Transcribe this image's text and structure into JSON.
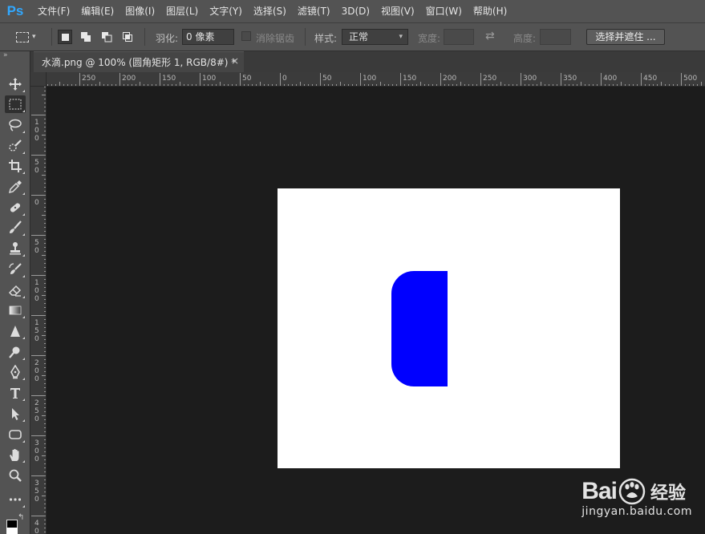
{
  "app": {
    "logo": "Ps"
  },
  "menu": [
    "文件(F)",
    "编辑(E)",
    "图像(I)",
    "图层(L)",
    "文字(Y)",
    "选择(S)",
    "滤镜(T)",
    "3D(D)",
    "视图(V)",
    "窗口(W)",
    "帮助(H)"
  ],
  "options": {
    "feather_label": "羽化:",
    "feather_value": "0 像素",
    "antialias_label": "消除锯齿",
    "style_label": "样式:",
    "style_value": "正常",
    "width_label": "宽度:",
    "height_label": "高度:",
    "select_mask_button": "选择并遮住 ..."
  },
  "document": {
    "tab_title": "水滴.png @ 100% (圆角矩形 1, RGB/8#) *",
    "close_glyph": "×",
    "shape_color": "#0000ff",
    "canvas_color": "#ffffff"
  },
  "rulers": {
    "horizontal": [
      "250",
      "200",
      "150",
      "100",
      "50",
      "0",
      "50",
      "100",
      "150",
      "200",
      "250",
      "300",
      "350",
      "400",
      "450",
      "500"
    ],
    "vertical": [
      "100",
      "50",
      "0",
      "50",
      "100",
      "150",
      "200",
      "250",
      "300",
      "350",
      "400"
    ]
  },
  "tools": [
    "move-icon",
    "rect-marquee-icon",
    "lasso-icon",
    "quick-select-icon",
    "crop-icon",
    "eyedropper-icon",
    "healing-brush-icon",
    "brush-icon",
    "clone-stamp-icon",
    "history-brush-icon",
    "eraser-icon",
    "gradient-icon",
    "blur-icon",
    "dodge-icon",
    "pen-icon",
    "type-icon",
    "path-select-icon",
    "rounded-rect-icon",
    "hand-icon",
    "zoom-icon",
    "more-tools-icon"
  ],
  "watermark": {
    "brand": "Bai",
    "brand_cn": "经验",
    "url": "jingyan.baidu.com"
  }
}
